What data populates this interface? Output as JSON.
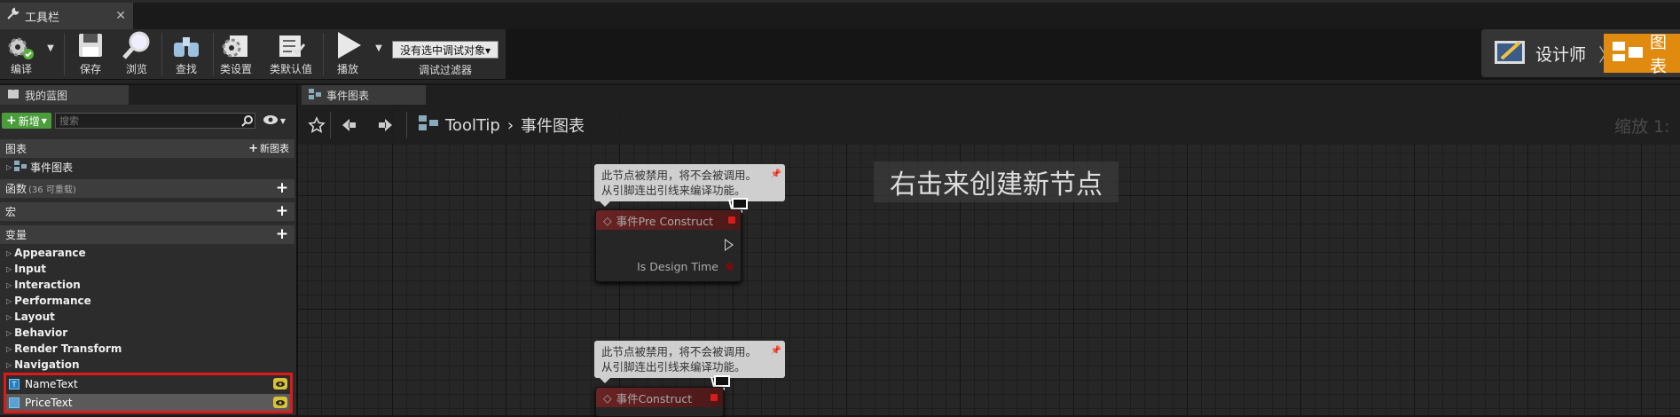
{
  "window_tab": {
    "label": "工具栏",
    "close": "✕"
  },
  "toolbar": {
    "compile": "编译",
    "save": "保存",
    "browse": "浏览",
    "find": "查找",
    "class_settings": "类设置",
    "class_defaults": "类默认值",
    "play": "播放",
    "debug_object": "没有选中调试对象▾",
    "debug_filter": "调试过滤器"
  },
  "mode": {
    "designer": "设计师",
    "graph": "图表"
  },
  "my_blueprint": {
    "tab": "我的蓝图",
    "new_button": "新增",
    "search_placeholder": "搜索",
    "graphs_header": "图表",
    "new_graph": "新图表",
    "event_graph": "事件图表",
    "functions_header": "函数",
    "functions_note": "(36 可重载)",
    "macros_header": "宏",
    "variables_header": "变量",
    "categories": [
      "Appearance",
      "Input",
      "Interaction",
      "Performance",
      "Layout",
      "Behavior",
      "Render Transform",
      "Navigation"
    ],
    "variables": [
      "NameText",
      "PriceText"
    ]
  },
  "graph": {
    "tab": "事件图表",
    "breadcrumb_root": "ToolTip",
    "breadcrumb_sep": "›",
    "breadcrumb_current": "事件图表",
    "zoom": "缩放 1:",
    "hint": "右击来创建新节点",
    "comment_line1": "此节点被禁用，将不会被调用。",
    "comment_line2": "从引脚连出引线来编译功能。",
    "node1_title": "事件Pre Construct",
    "node1_param": "Is Design Time",
    "node2_title": "事件Construct"
  },
  "colors": {
    "accent_orange": "#e08a10",
    "new_green": "#4a9d3a",
    "highlight_red": "#e01818",
    "event_header": "#6a2424"
  }
}
